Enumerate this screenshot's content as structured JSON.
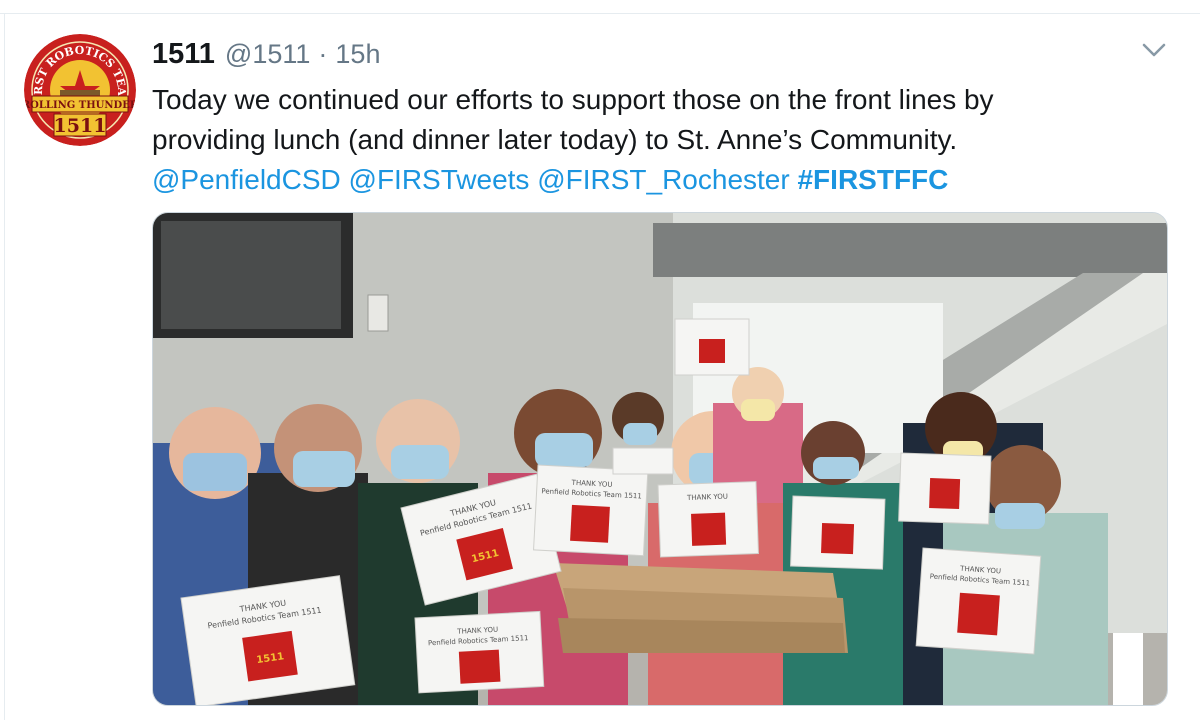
{
  "tweet": {
    "display_name": "1511",
    "handle": "@1511",
    "separator": "·",
    "timestamp": "15h",
    "text_line1": "Today we continued our efforts to support those on the front lines by",
    "text_line2": "providing lunch (and dinner later today) to St. Anne’s Community.",
    "mentions": [
      "@PenfieldCSD",
      "@FIRSTweets",
      "@FIRST_Rochester"
    ],
    "hashtag": "#FIRSTFFC"
  },
  "avatar": {
    "icon": "team-logo-icon",
    "ring_text": "FIRST ROBOTICS TEAM",
    "banner_text": "ROLLING THUNDER",
    "number": "1511"
  },
  "signs": {
    "line1": "THANK YOU",
    "line2": "Penfield Robotics Team 1511",
    "badge": "1511"
  },
  "colors": {
    "link": "#1b95e0",
    "secondary_text": "#657786",
    "logo_red": "#c8201e",
    "logo_gold": "#f2c232"
  }
}
